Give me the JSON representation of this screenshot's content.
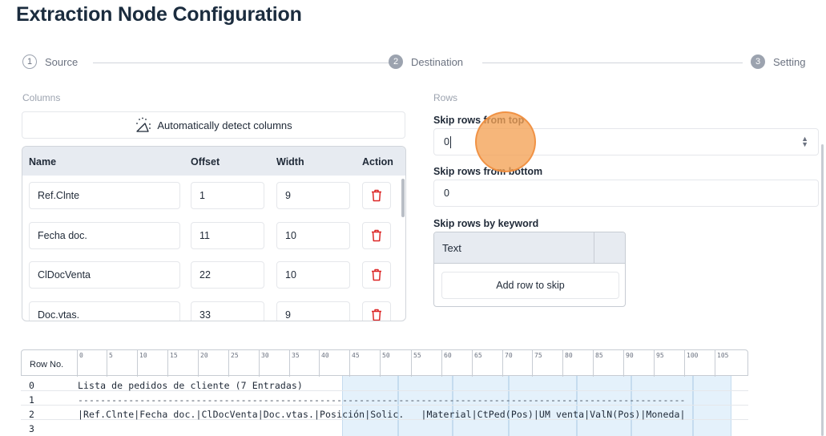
{
  "page": {
    "title": "Extraction Node Configuration"
  },
  "stepper": {
    "steps": [
      {
        "num": "1",
        "label": "Source"
      },
      {
        "num": "2",
        "label": "Destination"
      },
      {
        "num": "3",
        "label": "Setting"
      }
    ]
  },
  "columns": {
    "section_label": "Columns",
    "auto_detect_label": "Automatically detect columns",
    "headers": {
      "name": "Name",
      "offset": "Offset",
      "width": "Width",
      "action": "Action"
    },
    "rows": [
      {
        "name": "Ref.Clnte",
        "offset": "1",
        "width": "9"
      },
      {
        "name": "Fecha doc.",
        "offset": "11",
        "width": "10"
      },
      {
        "name": "ClDocVenta",
        "offset": "22",
        "width": "10"
      },
      {
        "name": "Doc.vtas.",
        "offset": "33",
        "width": "9"
      }
    ]
  },
  "rows_section": {
    "section_label": "Rows",
    "skip_top_label": "Skip rows from top",
    "skip_top_value": "0",
    "skip_bottom_label": "Skip rows from bottom",
    "skip_bottom_value": "0",
    "skip_keyword_label": "Skip rows by keyword",
    "keyword_header": "Text",
    "add_row_label": "Add row to skip"
  },
  "preview": {
    "row_no_label": "Row No.",
    "ticks": [
      "0",
      "5",
      "10",
      "15",
      "20",
      "25",
      "30",
      "35",
      "40",
      "45",
      "50",
      "55",
      "60",
      "65",
      "70",
      "75",
      "80",
      "85",
      "90",
      "95",
      "100",
      "105"
    ],
    "lines": [
      {
        "row": "0",
        "text": "Lista de pedidos de cliente (7 Entradas)"
      },
      {
        "row": "1",
        "text": "------------------------------------------------------------------------------------------------------------"
      },
      {
        "row": "2",
        "text": "|Ref.Clnte|Fecha doc.|ClDocVenta|Doc.vtas.|Posición|Solic.   |Material|CtPed(Pos)|UM venta|ValN(Pos)|Moneda|"
      },
      {
        "row": "3",
        "text": ""
      }
    ]
  },
  "colors": {
    "accent": "#f4a254",
    "delete": "#dc2626",
    "header_bg": "#e7ebf1",
    "band": "#e4f1fb"
  }
}
